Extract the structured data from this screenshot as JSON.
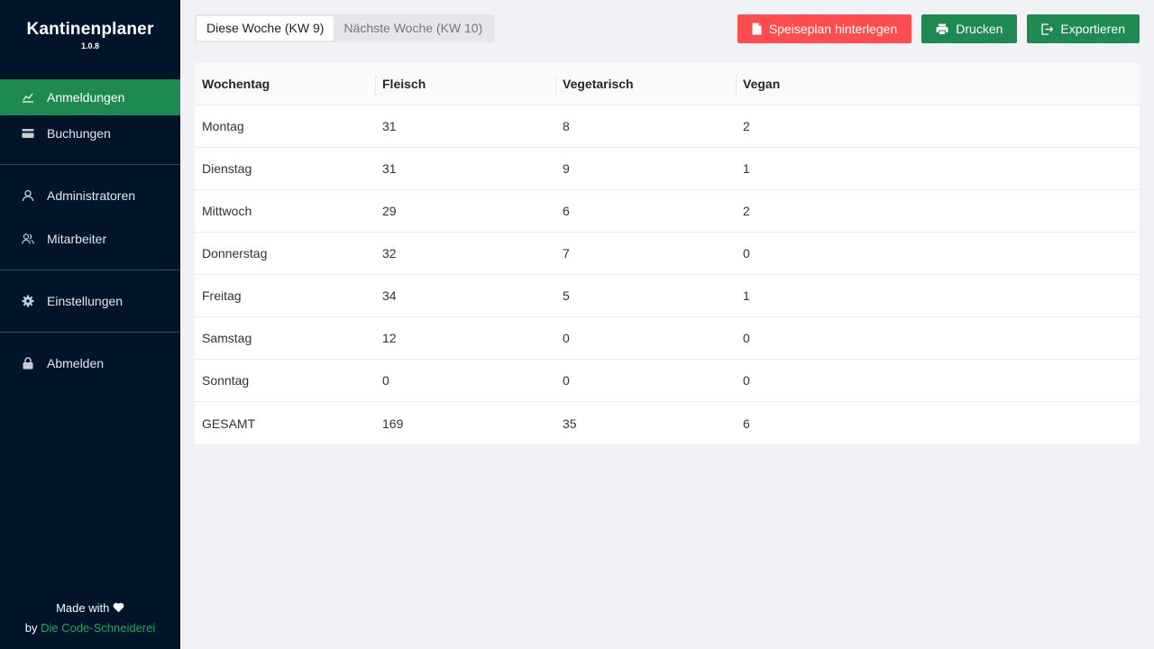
{
  "app": {
    "title": "Kantinenplaner",
    "version": "1.0.8"
  },
  "sidebar": {
    "groups": [
      [
        {
          "label": "Anmeldungen",
          "icon": "line-chart-icon",
          "active": true
        },
        {
          "label": "Buchungen",
          "icon": "credit-card-icon"
        }
      ],
      [
        {
          "label": "Administratoren",
          "icon": "user-icon"
        },
        {
          "label": "Mitarbeiter",
          "icon": "team-icon"
        }
      ],
      [
        {
          "label": "Einstellungen",
          "icon": "gear-icon"
        }
      ],
      [
        {
          "label": "Abmelden",
          "icon": "lock-icon"
        }
      ]
    ],
    "footer": {
      "made_with": "Made with",
      "by": "by",
      "link": "Die Code-Schneiderei"
    }
  },
  "tabs": [
    {
      "label": "Diese Woche (KW 9)",
      "active": true
    },
    {
      "label": "Nächste Woche (KW 10)",
      "active": false
    }
  ],
  "actions": {
    "menu": "Speiseplan hinterlegen",
    "print": "Drucken",
    "export": "Exportieren"
  },
  "colors": {
    "primary": "#1e8a52",
    "danger": "#ff4d4f",
    "sidebar": "#001529"
  },
  "table": {
    "columns": [
      "Wochentag",
      "Fleisch",
      "Vegetarisch",
      "Vegan"
    ],
    "rows": [
      [
        "Montag",
        "31",
        "8",
        "2"
      ],
      [
        "Dienstag",
        "31",
        "9",
        "1"
      ],
      [
        "Mittwoch",
        "29",
        "6",
        "2"
      ],
      [
        "Donnerstag",
        "32",
        "7",
        "0"
      ],
      [
        "Freitag",
        "34",
        "5",
        "1"
      ],
      [
        "Samstag",
        "12",
        "0",
        "0"
      ],
      [
        "Sonntag",
        "0",
        "0",
        "0"
      ],
      [
        "GESAMT",
        "169",
        "35",
        "6"
      ]
    ]
  }
}
